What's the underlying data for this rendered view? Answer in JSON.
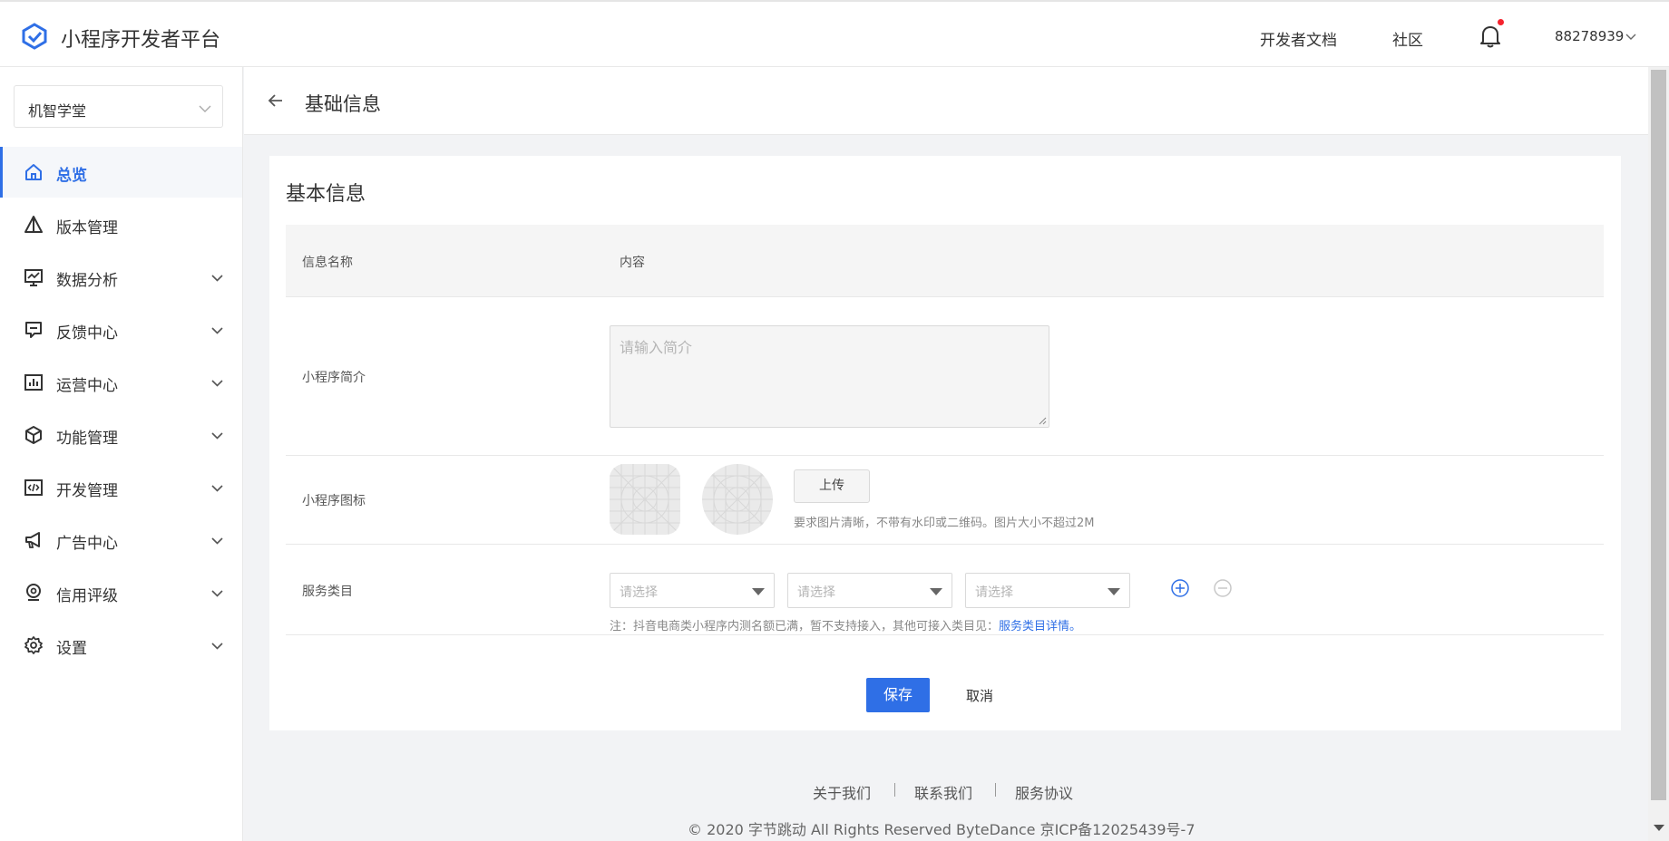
{
  "header": {
    "brand": "小程序开发者平台",
    "links": [
      "开发者文档",
      "社区"
    ],
    "user_id": "88278939",
    "colors": {
      "brand_blue": "#2f6fe6",
      "notification_dot": "#f5222d"
    }
  },
  "sidebar": {
    "app_selector": "机智学堂",
    "items": [
      {
        "label": "总览",
        "icon": "home-icon",
        "active": true
      },
      {
        "label": "版本管理",
        "icon": "version-icon"
      },
      {
        "label": "数据分析",
        "icon": "chart-monitor-icon"
      },
      {
        "label": "反馈中心",
        "icon": "feedback-icon"
      },
      {
        "label": "运营中心",
        "icon": "operations-icon"
      },
      {
        "label": "功能管理",
        "icon": "cube-icon"
      },
      {
        "label": "开发管理",
        "icon": "code-icon"
      },
      {
        "label": "广告中心",
        "icon": "megaphone-icon"
      },
      {
        "label": "信用评级",
        "icon": "credit-badge-icon"
      },
      {
        "label": "设置",
        "icon": "gear-icon"
      }
    ]
  },
  "page": {
    "title": "基础信息",
    "card_title": "基本信息",
    "columns": {
      "name": "信息名称",
      "content": "内容"
    },
    "rows": {
      "intro": {
        "label": "小程序简介",
        "placeholder": "请输入简介"
      },
      "icon": {
        "label": "小程序图标",
        "upload": "上传",
        "hint": "要求图片清晰，不带有水印或二维码。图片大小不超过2M"
      },
      "category": {
        "label": "服务类目",
        "selects": [
          "请选择",
          "请选择",
          "请选择"
        ],
        "note": "注：抖音电商类小程序内测名额已满，暂不支持接入，其他可接入类目见：",
        "note_link": "服务类目详情。"
      }
    },
    "actions": {
      "save": "保存",
      "cancel": "取消"
    }
  },
  "footer": {
    "links": [
      "关于我们",
      "联系我们",
      "服务协议"
    ],
    "copyright": "© 2020 字节跳动 All Rights Reserved ByteDance 京ICP备12025439号-7"
  }
}
